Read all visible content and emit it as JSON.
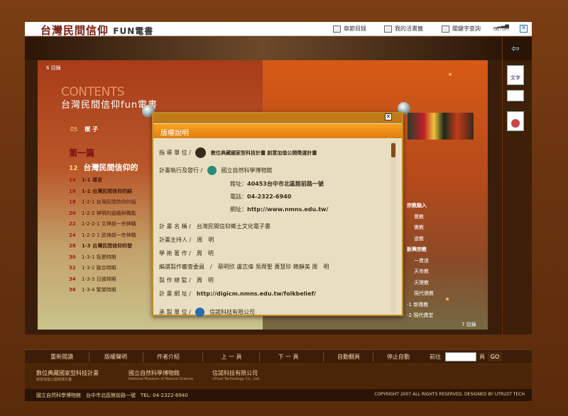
{
  "app": {
    "logo": "台灣民間信仰",
    "logo_suffix": "FUN電書"
  },
  "topnav": {
    "chapter": "章節目錄",
    "bookmark": "我的活書籤",
    "search": "關鍵字查詢",
    "sound": "ON / OFF",
    "close": "✕"
  },
  "book": {
    "left_page_num": "6  目錄",
    "right_page_num": "7  目錄",
    "contents": "CONTENTS",
    "title": "台灣民間信仰fun電書",
    "preface_num": "05",
    "preface": "楔 子",
    "part": "第一篇",
    "part_num": "12",
    "part_title": "台灣民間信仰的",
    "toc_left": [
      {
        "num": "14",
        "text": "1-1  導言",
        "bold": true
      },
      {
        "num": "16",
        "text": "1-2  台灣民間信仰的結",
        "bold": true
      },
      {
        "num": "18",
        "text": "1-2-1  台灣民間信仰的結",
        "bold": false
      },
      {
        "num": "20",
        "text": "1-2-2  神明的組織與職能",
        "bold": false
      },
      {
        "num": "22",
        "text": "1-2-2-1  文神部一宗神職",
        "bold": false
      },
      {
        "num": "24",
        "text": "1-2-2-1  武神部一宗神職",
        "bold": false
      },
      {
        "num": "28",
        "text": "1-3  台灣民間信仰的發",
        "bold": true
      },
      {
        "num": "30",
        "text": "1-3-1  拓墾時期",
        "bold": false
      },
      {
        "num": "32",
        "text": "1-3-2  融合時期",
        "bold": false
      },
      {
        "num": "34",
        "text": "1-3-3  日據時期",
        "bold": false
      },
      {
        "num": "36",
        "text": "1-3-4  繁榮時期",
        "bold": false
      }
    ],
    "toc_right": [
      {
        "text": "宗教融入",
        "bold": true
      },
      {
        "text": "儒教",
        "bold": false
      },
      {
        "text": "佛教",
        "bold": false
      },
      {
        "text": "道教",
        "bold": false
      },
      {
        "text": "新興宗教",
        "bold": true
      },
      {
        "text": "一貫道",
        "bold": false
      },
      {
        "text": "天帝教",
        "bold": false
      },
      {
        "text": "天理教",
        "bold": false
      },
      {
        "text": "現代儒教",
        "bold": false
      },
      {
        "text": "-1  新儒教",
        "bold": false
      },
      {
        "text": "-2  現代儒堂",
        "bold": false
      }
    ]
  },
  "side": {
    "text_icon": "文字"
  },
  "modal": {
    "title": "版權說明",
    "close": "✕",
    "rows": {
      "guide_label": "指 導 單 位  /",
      "guide_value": "數位典藏國家型科技計畫 創意加值公開徵選計畫",
      "exec_label": "計畫執行及發行  /",
      "exec_value": "國立自然科學博物館",
      "addr_label": "館址：",
      "addr_value": "40453台中市北區館前路一號",
      "tel_label": "電話：",
      "tel_value": "04-2322-6940",
      "web_label": "網址：",
      "web_value": "http://www.nmns.edu.tw/",
      "name_label": "計 畫 名 稱  /",
      "name_value": "台灣民間信仰鄉土文化電子書",
      "host_label": "計畫主持人  /",
      "host_value": "周　明",
      "author_label": "學 術 著 作  /",
      "author_value": "周　明",
      "edit_label": "編選製作審查委員",
      "edit_value": "/　蔡明欣 盧志偉 吳舜聖 黃慧珍 賴靜美 周　明",
      "supervise_label": "製 作 總 監  /",
      "supervise_value": "周　明",
      "url_label": "計 畫 網 址  /",
      "url_value": "http://digicm.nmns.edu.tw/folkbelief/",
      "maker_label": "承 製 單 位  /",
      "maker_value": "信諾科技有限公司"
    }
  },
  "bottom": {
    "replay": "重新閱讀",
    "copyright": "版權聲明",
    "author": "作者介紹",
    "prev": "上 一 頁",
    "next": "下 一 頁",
    "autoflip": "自動翻頁",
    "stop": "停止自動",
    "goto": "前往",
    "page": "頁",
    "go": "GO"
  },
  "sponsors": {
    "s1": "數位典藏國家型科技計畫",
    "s1_sub": "創意加值公開徵選計畫",
    "s2": "國立自然科學博物館",
    "s2_sub": "National Museum of Natural Science",
    "s3": "信諾科技有限公司",
    "s3_sub": "uTrust Technology Co., Ltd."
  },
  "footer": {
    "left": "國立自然科學博物館　台中市北區館前路一號　TEL: 04-2322-6940",
    "right": "COPYRIGHT 2007  ALL RIGHTS RESERVED. DESIGNED BY UTRUST TECH"
  }
}
